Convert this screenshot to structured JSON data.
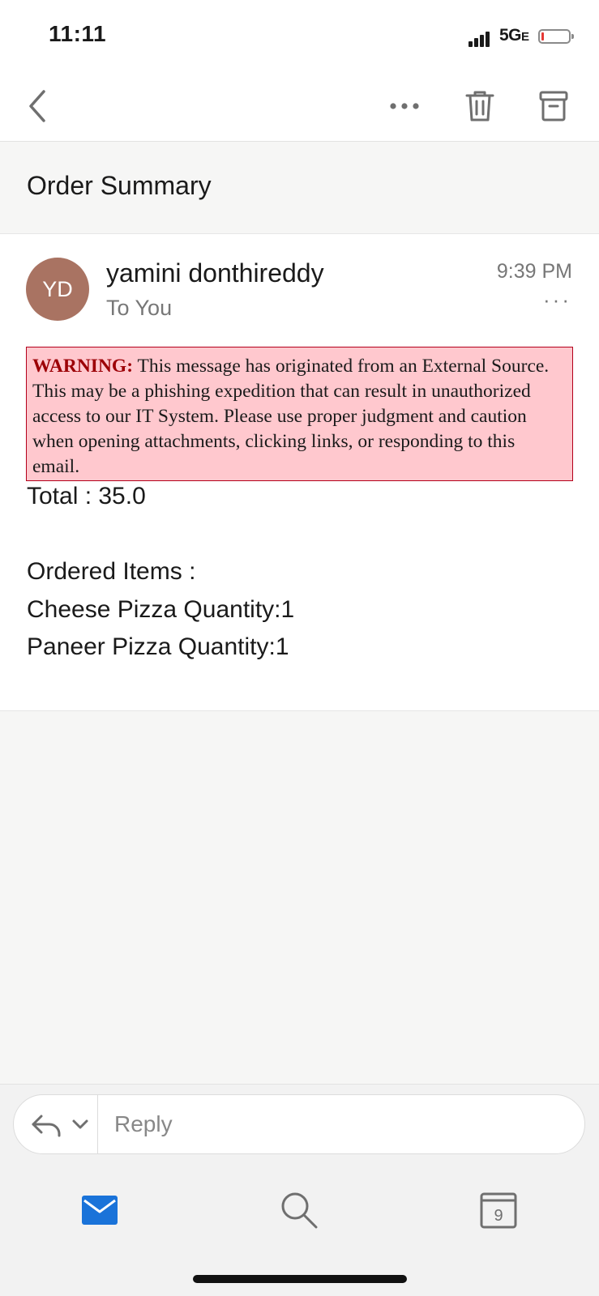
{
  "status_bar": {
    "time": "11:11",
    "network": "5G",
    "network_suffix": "E"
  },
  "toolbar": {
    "back_icon": "chevron-left-icon",
    "more_icon": "ellipsis-icon",
    "delete_icon": "trash-icon",
    "archive_icon": "archive-icon"
  },
  "subject": "Order Summary",
  "message": {
    "avatar_initials": "YD",
    "avatar_color": "#a97362",
    "sender": "yamini donthireddy",
    "recipient": "To You",
    "time": "9:39 PM",
    "more": "···",
    "warning": {
      "label": "WARNING:",
      "text": " This message has originated from an External Source. This may be a phishing expedition that can result in unauthorized access to our IT System. Please use proper judgment and caution when opening attachments, clicking links, or responding to this email."
    },
    "body": {
      "total": "Total : 35.0",
      "ordered_heading": "Ordered Items :",
      "items": [
        "Cheese Pizza Quantity:1",
        "Paneer Pizza Quantity:1"
      ]
    }
  },
  "reply": {
    "placeholder": "Reply"
  },
  "tab_bar": {
    "mail_icon": "mail-icon",
    "search_icon": "search-icon",
    "calendar_icon": "calendar-icon",
    "calendar_day": "9",
    "accent_color": "#1a73d9"
  }
}
